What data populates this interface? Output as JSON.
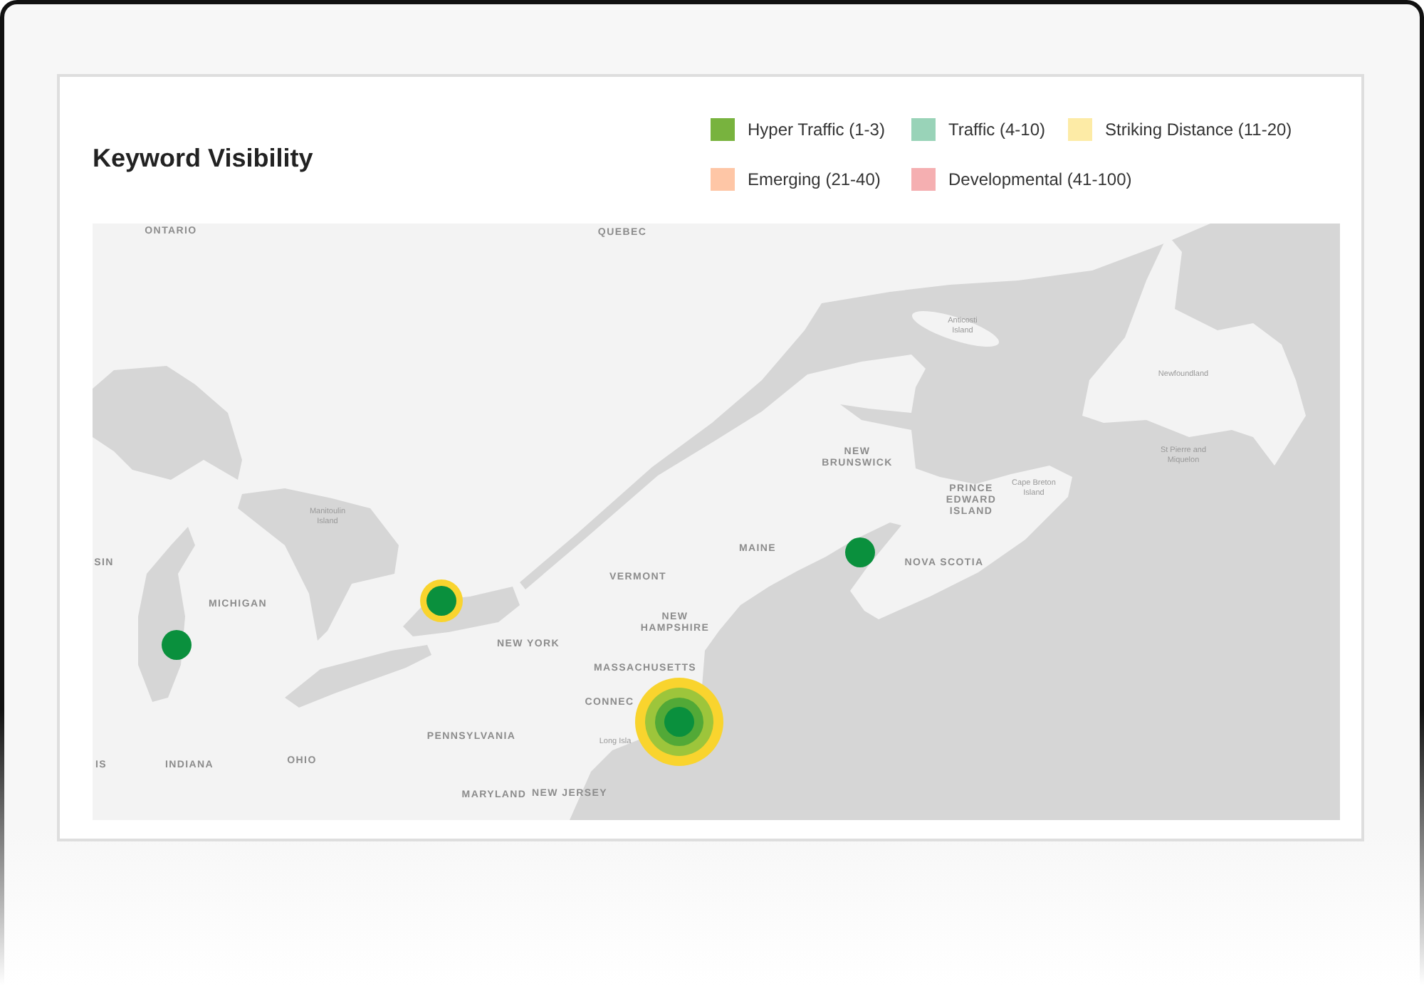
{
  "title": "Keyword Visibility",
  "legend": [
    {
      "label": "Hyper Traffic (1-3)",
      "color": "#78b33e"
    },
    {
      "label": "Traffic (4-10)",
      "color": "#99d3b8"
    },
    {
      "label": "Striking Distance (11-20)",
      "color": "#fdeba6"
    },
    {
      "label": "Emerging (21-40)",
      "color": "#fec6a6"
    },
    {
      "label": "Developmental (41-100)",
      "color": "#f5afb1"
    }
  ],
  "map": {
    "labels": [
      {
        "text": "ONTARIO",
        "kind": "region"
      },
      {
        "text": "QUEBEC",
        "kind": "region"
      },
      {
        "text": "Anticosti Island",
        "kind": "place"
      },
      {
        "text": "Newfoundland",
        "kind": "place"
      },
      {
        "text": "NEW BRUNSWICK",
        "kind": "region"
      },
      {
        "text": "St Pierre and Miquelon",
        "kind": "place"
      },
      {
        "text": "Cape Breton Island",
        "kind": "place"
      },
      {
        "text": "PRINCE EDWARD ISLAND",
        "kind": "region"
      },
      {
        "text": "Manitoulin Island",
        "kind": "place"
      },
      {
        "text": "MAINE",
        "kind": "region"
      },
      {
        "text": "SIN",
        "kind": "region"
      },
      {
        "text": "NOVA SCOTIA",
        "kind": "region"
      },
      {
        "text": "VERMONT",
        "kind": "region"
      },
      {
        "text": "MICHIGAN",
        "kind": "region"
      },
      {
        "text": "NEW HAMPSHIRE",
        "kind": "region"
      },
      {
        "text": "NEW YORK",
        "kind": "region"
      },
      {
        "text": "MASSACHUSETTS",
        "kind": "region"
      },
      {
        "text": "CONNEC",
        "kind": "region"
      },
      {
        "text": "PENNSYLVANIA",
        "kind": "region"
      },
      {
        "text": "Long Isla",
        "kind": "place"
      },
      {
        "text": "OHIO",
        "kind": "region"
      },
      {
        "text": "IS",
        "kind": "region"
      },
      {
        "text": "INDIANA",
        "kind": "region"
      },
      {
        "text": "NEW JERSEY",
        "kind": "region"
      },
      {
        "text": "MARYLAND",
        "kind": "region"
      }
    ],
    "markers": [
      {
        "rings": [
          {
            "color": "#0a903d"
          }
        ]
      },
      {
        "rings": [
          {
            "color": "#f9d42e"
          },
          {
            "color": "#0a903d"
          }
        ]
      },
      {
        "rings": [
          {
            "color": "#0a903d"
          }
        ]
      },
      {
        "rings": [
          {
            "color": "#f9d42e"
          },
          {
            "color": "#9dc53b"
          },
          {
            "color": "#52a937"
          },
          {
            "color": "#0a903d"
          }
        ]
      }
    ]
  }
}
